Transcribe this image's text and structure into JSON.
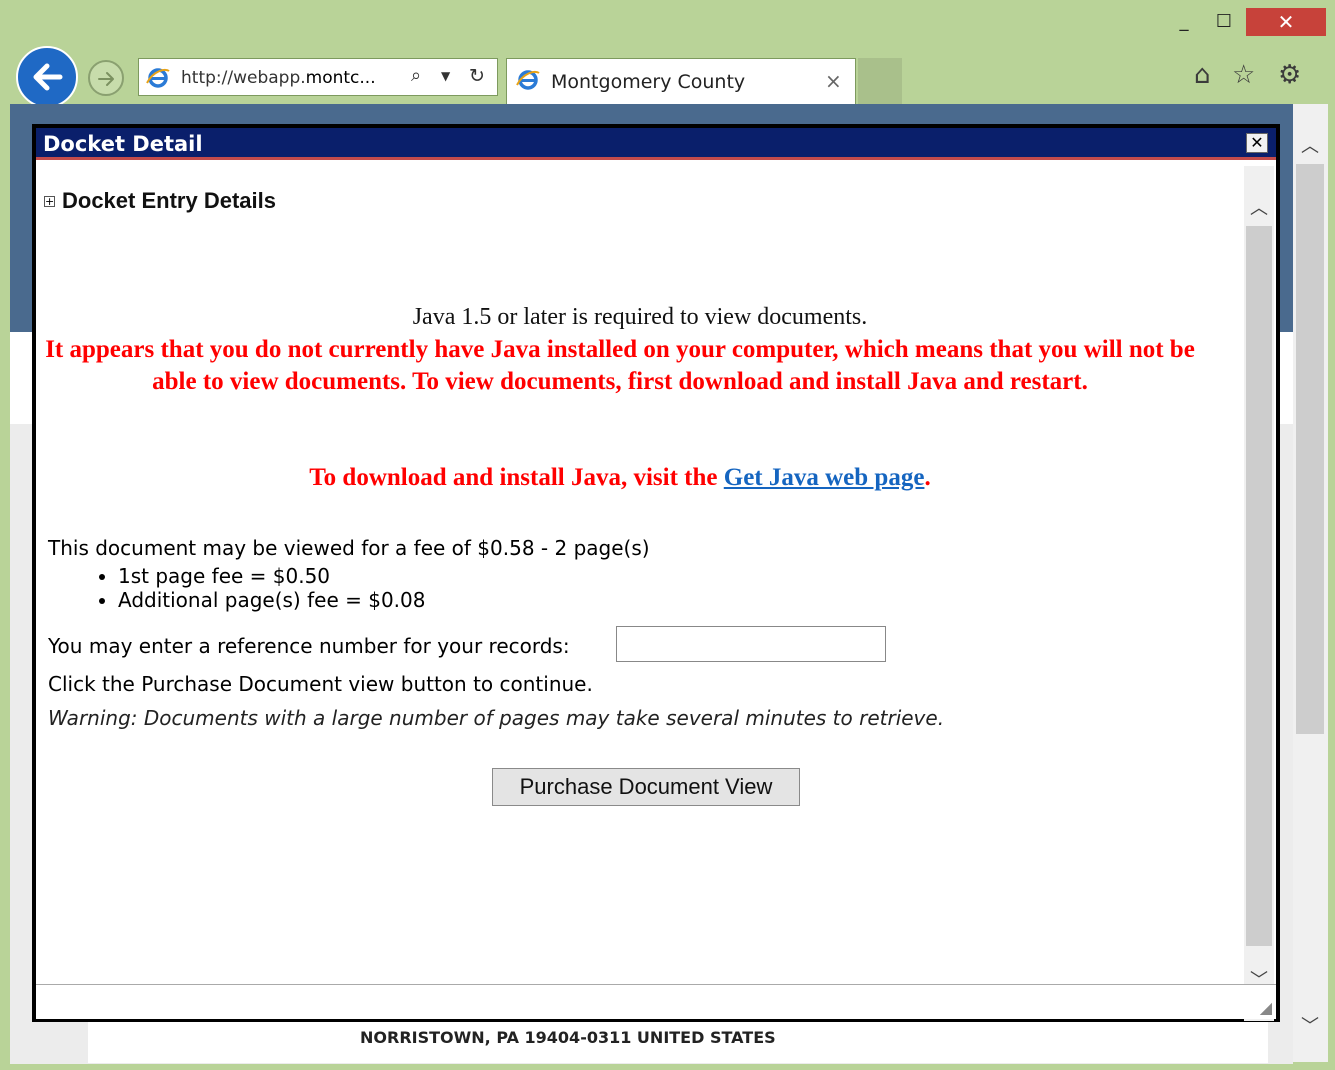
{
  "browser": {
    "url_prefix": "http://webapp.",
    "url_domain": "montc...",
    "tab_title": "Montgomery County",
    "tab_close": "×",
    "window_minimize": "_",
    "window_maximize": "☐",
    "window_close": "✕",
    "icons": [
      "back-arrow-icon",
      "forward-arrow-icon",
      "ie-logo-icon",
      "search-icon",
      "dropdown-icon",
      "refresh-icon",
      "home-icon",
      "favorites-star-icon",
      "settings-gear-icon"
    ]
  },
  "background_page": {
    "address_text": "NORRISTOWN, PA 19404-0311 UNITED STATES"
  },
  "dialog": {
    "title": "Docket Detail",
    "close": "✕",
    "section_toggle": "+",
    "section_title": "Docket Entry Details",
    "java_required": "Java 1.5 or later is required to view documents.",
    "java_warning": "It appears that you do not currently have Java installed on your computer, which means that you will not be able to view documents. To view documents, first download and install Java and restart.",
    "java_download_prefix": "To download and install Java, visit the ",
    "java_download_link": "Get Java web page",
    "java_download_suffix": ".",
    "fee_line": "This document may be viewed for a fee of $0.58 - 2 page(s)",
    "fees": [
      "1st page fee = $0.50",
      "Additional page(s) fee = $0.08"
    ],
    "reference_label": "You may enter a reference number for your records:",
    "reference_value": "",
    "click_instruction": "Click the Purchase Document view button to continue.",
    "warning": "Warning: Documents with a large number of pages may take several minutes to retrieve.",
    "purchase_button": "Purchase Document View"
  },
  "colors": {
    "chrome": "#b9d398",
    "dialog_title_bar": "#0a1f6b",
    "warning_red": "#ff0000",
    "link_blue": "#1565c0"
  }
}
